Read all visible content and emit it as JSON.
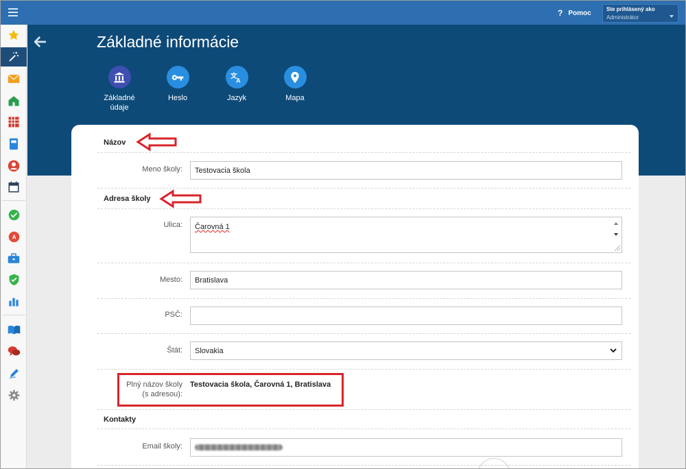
{
  "topbar": {
    "help_label": "Pomoc",
    "help_icon": "?",
    "user_label": "Ste prihlásený ako",
    "user_role": "Administrátor"
  },
  "sidebar": {
    "items": [
      {
        "icon": "star-icon",
        "color": "#f5b800"
      },
      {
        "icon": "magic-wand-icon",
        "color": "#ffffff",
        "active": true
      },
      {
        "icon": "envelope-icon",
        "color": "#f0a020"
      },
      {
        "icon": "school-building-icon",
        "color": "#2a9d4e"
      },
      {
        "icon": "timetable-grid-icon",
        "color": "#d43a2f"
      },
      {
        "icon": "class-book-icon",
        "color": "#2a86d9"
      },
      {
        "icon": "person-icon",
        "color": "#d94536"
      },
      {
        "icon": "calendar-icon",
        "color": "#2a3e58"
      },
      {
        "icon": "check-circle-icon",
        "color": "#36b34a"
      },
      {
        "icon": "grade-icon",
        "color": "#e04a3a"
      },
      {
        "icon": "briefcase-icon",
        "color": "#2a86d9"
      },
      {
        "icon": "shield-check-icon",
        "color": "#36b34a"
      },
      {
        "icon": "bar-chart-icon",
        "color": "#2a86d9"
      },
      {
        "icon": "open-book-icon",
        "color": "#2a86d9"
      },
      {
        "icon": "chat-bubbles-icon",
        "color": "#d43a2f"
      },
      {
        "icon": "pen-icon",
        "color": "#2a86d9"
      },
      {
        "icon": "gear-icon",
        "color": "#8a8a8a"
      }
    ]
  },
  "header": {
    "title": "Základné informácie",
    "tabs": [
      {
        "line1": "Základné",
        "line2": "údaje",
        "icon": "bank-building-icon",
        "selected": true
      },
      {
        "line1": "Heslo",
        "line2": "",
        "icon": "key-icon"
      },
      {
        "line1": "Jazyk",
        "line2": "",
        "icon": "translate-icon"
      },
      {
        "line1": "Mapa",
        "line2": "",
        "icon": "map-pin-icon"
      }
    ]
  },
  "form": {
    "sections": {
      "name": "Názov",
      "address": "Adresa školy",
      "contacts": "Kontakty"
    },
    "school_name": {
      "label": "Meno školy:",
      "value": "Testovacia škola"
    },
    "street": {
      "label": "Ulica:",
      "value": "Čarovná 1"
    },
    "city": {
      "label": "Mesto:",
      "value": "Bratislava"
    },
    "zip": {
      "label": "PSČ:",
      "value": ""
    },
    "country": {
      "label": "Štát:",
      "value": "Slovakia"
    },
    "full_name": {
      "label_line1": "Plný názov školy",
      "label_line2": "(s adresou):",
      "value": "Testovacia škola, Čarovná 1, Bratislava"
    },
    "email": {
      "label": "Email školy:",
      "value_hidden": true
    }
  },
  "annotation_color": "#d8232a"
}
